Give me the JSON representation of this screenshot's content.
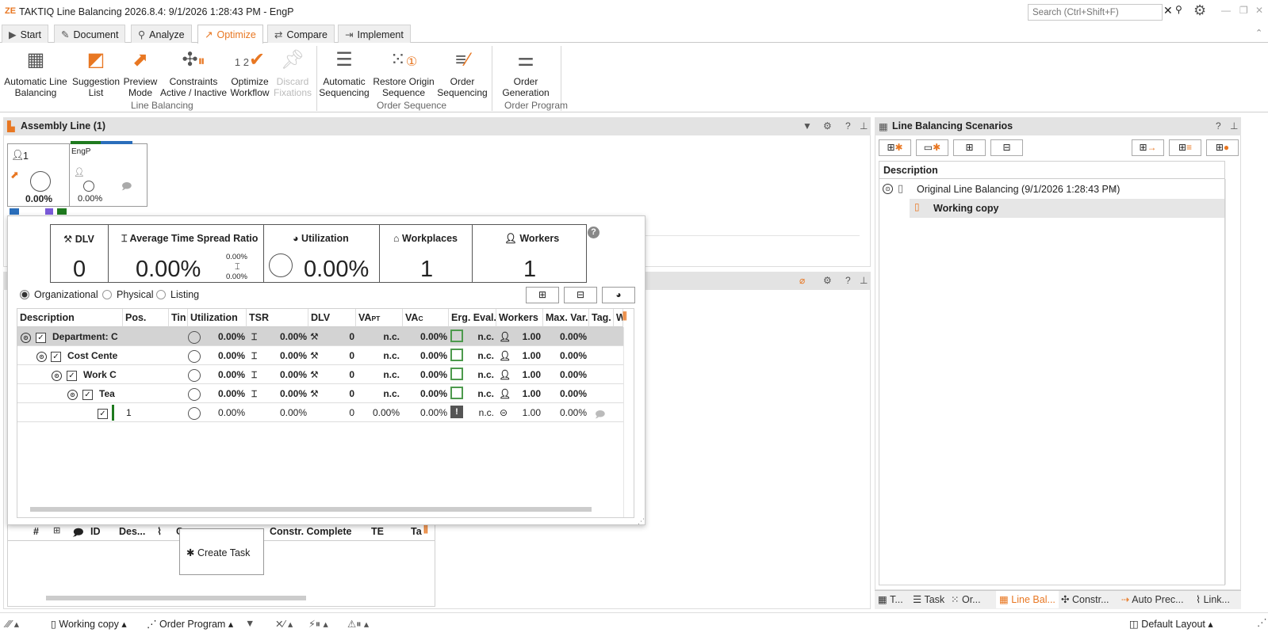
{
  "window": {
    "title": "TAKTIQ Line Balancing 2026.8.4: 9/1/2026 1:28:43 PM - EngP",
    "logo": "ZE",
    "search_placeholder": "Search (Ctrl+Shift+F)"
  },
  "colors": {
    "accent": "#e87722",
    "panel_header": "#e3e3e3",
    "green": "#4d9a4d",
    "dark_green": "#1f7a1f",
    "blue": "#2a6ebb"
  },
  "tabs": [
    {
      "label": "Start",
      "icon": "play-icon"
    },
    {
      "label": "Document",
      "icon": "pencil-icon"
    },
    {
      "label": "Analyze",
      "icon": "search-icon"
    },
    {
      "label": "Optimize",
      "icon": "trend-icon",
      "active": true
    },
    {
      "label": "Compare",
      "icon": "compare-icon"
    },
    {
      "label": "Implement",
      "icon": "implement-icon"
    }
  ],
  "ribbon": {
    "buttons": [
      {
        "line1": "Automatic Line",
        "line2": "Balancing"
      },
      {
        "line1": "Suggestion",
        "line2": "List"
      },
      {
        "line1": "Preview",
        "line2": "Mode"
      },
      {
        "line1": "Constraints",
        "line2": "Active / Inactive"
      },
      {
        "line1": "Optimize",
        "line2": "Workflow"
      },
      {
        "line1": "Discard",
        "line2": "Fixations"
      },
      {
        "line1": "Automatic",
        "line2": "Sequencing"
      },
      {
        "line1": "Restore Origin",
        "line2": "Sequence"
      },
      {
        "line1": "Order",
        "line2": "Sequencing"
      },
      {
        "line1": "Order",
        "line2": "Generation"
      }
    ],
    "optimize_workflow_numbers": "1 2",
    "groups": [
      "Line Balancing",
      "Order Sequence",
      "Order Program"
    ]
  },
  "assembly_panel": {
    "title": "Assembly Line (1)",
    "station": {
      "worker_count": "1",
      "utilization": "0.00%",
      "name": "EngP",
      "sub_utilization": "0.00%"
    }
  },
  "kpis": [
    {
      "title": "DLV",
      "value": "0"
    },
    {
      "title": "Average Time Spread Ratio",
      "value": "0.00%",
      "upper": "0.00%",
      "lower": "0.00%"
    },
    {
      "title": "Utilization",
      "value": "0.00%"
    },
    {
      "title": "Workplaces",
      "value": "1"
    },
    {
      "title": "Workers",
      "value": "1"
    }
  ],
  "view_options": [
    {
      "label": "Organizational",
      "selected": true
    },
    {
      "label": "Physical",
      "selected": false
    },
    {
      "label": "Listing",
      "selected": false
    }
  ],
  "grid": {
    "headers": [
      "Description",
      "Pos.",
      "Tin",
      "Utilization",
      "TSR",
      "DLV",
      "VAPT",
      "VAC",
      "Erg. Eval.",
      "Workers",
      "Max. Var.",
      "Tag.",
      "W"
    ],
    "va_main": "VA",
    "va_sub_pt": "PT",
    "va_sub_c": "C",
    "rows": [
      {
        "description": "Department: C",
        "pos": "",
        "utilization": "0.00%",
        "tsr": "0.00%",
        "dlv": "0",
        "vapt": "n.c.",
        "vac": "0.00%",
        "erg": "n.c.",
        "workers": "1.00",
        "maxvar": "0.00%"
      },
      {
        "description": "Cost Cente",
        "pos": "",
        "utilization": "0.00%",
        "tsr": "0.00%",
        "dlv": "0",
        "vapt": "n.c.",
        "vac": "0.00%",
        "erg": "n.c.",
        "workers": "1.00",
        "maxvar": "0.00%"
      },
      {
        "description": "Work C",
        "pos": "",
        "utilization": "0.00%",
        "tsr": "0.00%",
        "dlv": "0",
        "vapt": "n.c.",
        "vac": "0.00%",
        "erg": "n.c.",
        "workers": "1.00",
        "maxvar": "0.00%"
      },
      {
        "description": "Tea",
        "pos": "",
        "utilization": "0.00%",
        "tsr": "0.00%",
        "dlv": "0",
        "vapt": "n.c.",
        "vac": "0.00%",
        "erg": "n.c.",
        "workers": "1.00",
        "maxvar": "0.00%"
      },
      {
        "description": "",
        "pos": "1",
        "utilization": "0.00%",
        "tsr": "0.00%",
        "dlv": "0",
        "vapt": "0.00%",
        "vac": "0.00%",
        "erg": "n.c.",
        "workers": "1.00",
        "maxvar": "0.00%"
      }
    ]
  },
  "task_table": {
    "headers": [
      "#",
      "ID",
      "Des...",
      "C",
      "Constr. Complete",
      "TE",
      "Ta"
    ],
    "context_menu": "Create Task"
  },
  "scenarios_panel": {
    "title": "Line Balancing Scenarios",
    "column": "Description",
    "items": [
      {
        "label": "Original Line Balancing (9/1/2026 1:28:43 PM)"
      },
      {
        "label": "Working copy"
      }
    ]
  },
  "bottom_tabs": [
    "T...",
    "Task",
    "Or...",
    "Line Bal...",
    "Constr...",
    "Auto Prec...",
    "Link..."
  ],
  "statusbar": {
    "working_copy": "Working copy",
    "order_program": "Order Program",
    "layout": "Default Layout"
  }
}
